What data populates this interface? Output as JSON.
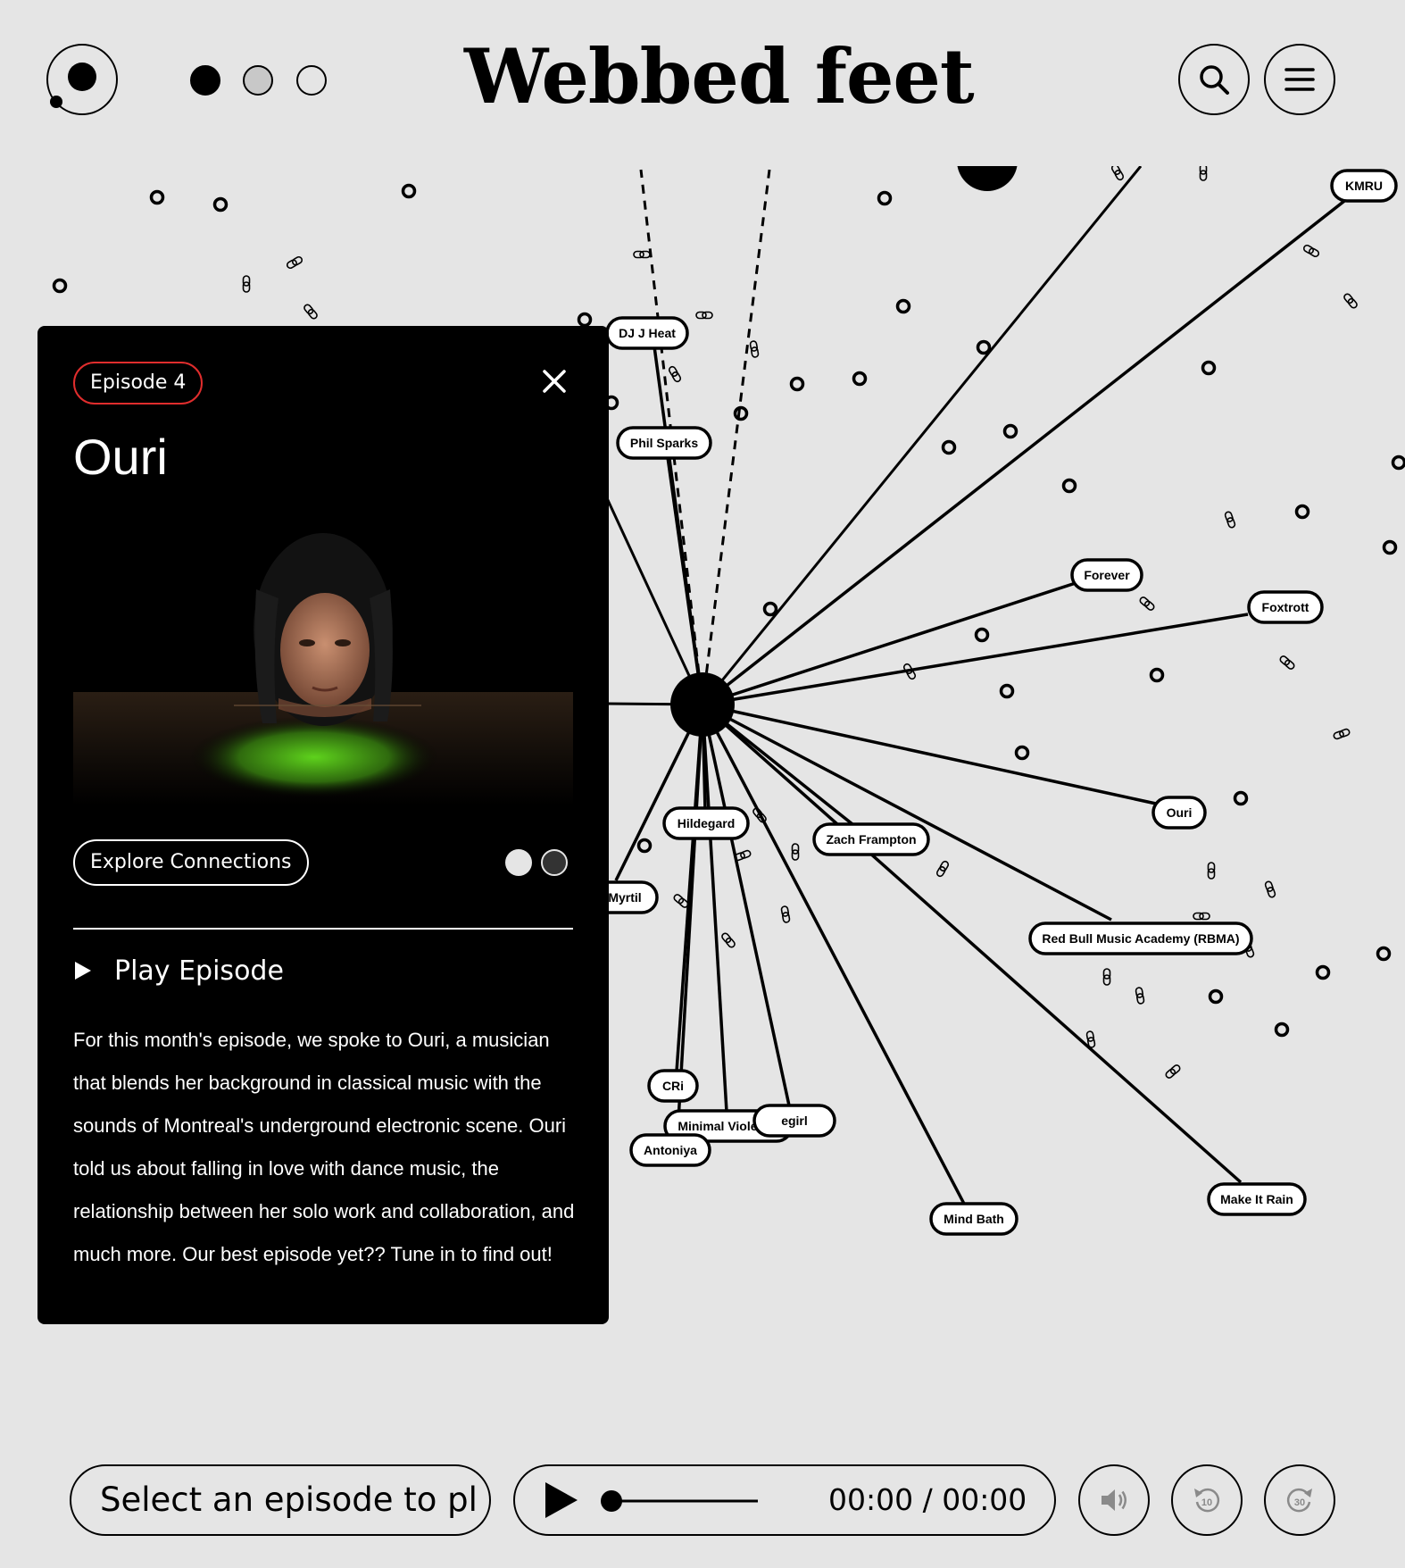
{
  "header": {
    "title": "Webbed feet",
    "logo_icon": "logo-orbit-icon",
    "mode_dots": [
      "filled",
      "grey",
      "outline"
    ],
    "search_icon": "search-icon",
    "menu_icon": "hamburger-menu-icon"
  },
  "graph": {
    "hub_node": "episode-hub",
    "nodes": [
      {
        "label": "KMRU"
      },
      {
        "label": "DJ J Heat"
      },
      {
        "label": "Phil Sparks"
      },
      {
        "label": "Forever"
      },
      {
        "label": "Foxtrott"
      },
      {
        "label": "Ouri"
      },
      {
        "label": "Hildegard"
      },
      {
        "label": "Zach Frampton"
      },
      {
        "label": "Myrtil"
      },
      {
        "label": "Red Bull Music Academy (RBMA)"
      },
      {
        "label": "CRi"
      },
      {
        "label": "Minimal Violence"
      },
      {
        "label": "egirl"
      },
      {
        "label": "Antoniya"
      },
      {
        "label": "Mind Bath"
      },
      {
        "label": "Make It Rain"
      }
    ],
    "decor_icons": [
      "circle-node-icon",
      "link-chain-icon"
    ]
  },
  "panel": {
    "badge": "Episode 4",
    "badge_color": "#e02d2d",
    "title": "Ouri",
    "close_icon": "close-icon",
    "explore_label": "Explore Connections",
    "play_label": "Play Episode",
    "description": "For this month's episode, we spoke to Ouri, a musician that blends her background in classical music with the sounds of Montreal's underground electronic scene. Ouri told us about falling in love with dance music, the relationship between her solo work and collaboration, and much more. Our best episode yet?? Tune in to find out!"
  },
  "player": {
    "now_playing": "Select an episode to pl",
    "time": "00:00 / 00:00",
    "progress": 0,
    "volume_icon": "volume-icon",
    "rewind_icon": "rewind-10-icon",
    "forward_icon": "forward-30-icon"
  }
}
